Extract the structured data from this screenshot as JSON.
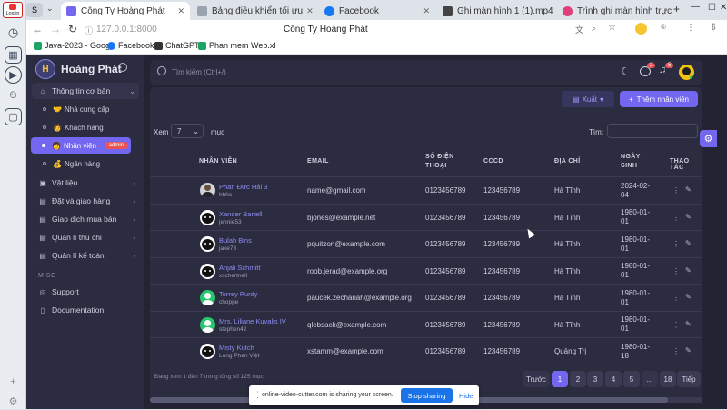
{
  "dock": {
    "login": "Log in"
  },
  "tabs": [
    {
      "label": "Công Ty Hoàng Phát",
      "active": true
    },
    {
      "label": "Bảng điều khiển tối ưu",
      "active": false
    },
    {
      "label": "Facebook",
      "active": false
    },
    {
      "label": "Ghi màn hình 1 (1).mp4",
      "active": false
    },
    {
      "label": "Trình ghi màn hình trực",
      "active": false
    }
  ],
  "address": {
    "url": "127.0.0.1:8000",
    "page_title": "Công Ty Hoàng Phát"
  },
  "bookmarks": [
    "Java-2023 - Googl",
    "Facebook",
    "ChatGPT",
    "Phan mem Web.xl"
  ],
  "brand": {
    "name": "Hoàng Phát"
  },
  "sidebar": {
    "group_title": "Thông tin cơ bản",
    "sub_items": [
      {
        "label": "Nhà cung cấp",
        "emoji": "🤝"
      },
      {
        "label": "Khách hàng",
        "emoji": "🧑"
      },
      {
        "label": "Nhân viên",
        "emoji": "🧑",
        "badge": "admin"
      },
      {
        "label": "Ngân hàng",
        "emoji": "💰"
      }
    ],
    "items": [
      "Vật liệu",
      "Đặt và giao hàng",
      "Giao dịch mua bán",
      "Quản lí thu chi",
      "Quản lí kế toán"
    ],
    "misc_title": "MISC",
    "misc_items": [
      "Support",
      "Documentation"
    ]
  },
  "search": {
    "placeholder": "Tìm kiếm (Ctrl+/)"
  },
  "header_badges": {
    "messages": "2",
    "notifications": "5"
  },
  "toolbar": {
    "export": "Xuất",
    "add_employee": "Thêm nhân viên"
  },
  "list_controls": {
    "show_label": "Xem",
    "show_value": "7",
    "entries_label": "mục",
    "search_label": "Tìm:"
  },
  "table": {
    "columns": [
      "NHÂN VIÊN",
      "EMAIL",
      "SỐ ĐIỆN THOẠI",
      "CCCD",
      "ĐỊA CHỈ",
      "NGÀY SINH",
      "THAO TÁC"
    ],
    "rows": [
      {
        "name": "Phan Đức Hải 3",
        "username": "hhhc",
        "email": "name@gmail.com",
        "phone": "0123456789",
        "cccd": "123456789",
        "address": "Hà Tĩnh",
        "dob": "2024-02-04",
        "avatar": "photo"
      },
      {
        "name": "Xander Bartell",
        "username": "jennie53",
        "email": "bjones@example.net",
        "phone": "0123456789",
        "cccd": "123456789",
        "address": "Hà Tĩnh",
        "dob": "1980-01-01",
        "avatar": "cat"
      },
      {
        "name": "Bulah Bins",
        "username": "jake78",
        "email": "pquitzon@example.com",
        "phone": "0123456789",
        "cccd": "123456789",
        "address": "Hà Tĩnh",
        "dob": "1980-01-01",
        "avatar": "cat"
      },
      {
        "name": "Anjali Schmitt",
        "username": "xschertnell",
        "email": "roob.jerad@example.org",
        "phone": "0123456789",
        "cccd": "123456789",
        "address": "Hà Tĩnh",
        "dob": "1980-01-01",
        "avatar": "cat"
      },
      {
        "name": "Torrey Purdy",
        "username": "choppe",
        "email": "paucek.zechariah@example.org",
        "phone": "0123456789",
        "cccd": "123456789",
        "address": "Hà Tĩnh",
        "dob": "1980-01-01",
        "avatar": "person"
      },
      {
        "name": "Mrs. Liliane Kuvalis IV",
        "username": "stephen42",
        "email": "qlebsack@example.com",
        "phone": "0123456789",
        "cccd": "123456789",
        "address": "Hà Tĩnh",
        "dob": "1980-01-01",
        "avatar": "person"
      },
      {
        "name": "Misty Kutch",
        "username": "Long Phan Việt",
        "email": "xstamm@example.com",
        "phone": "0123456789",
        "cccd": "123456789",
        "address": "Quảng Trị",
        "dob": "1980-01-18",
        "avatar": "cat"
      }
    ]
  },
  "footer": {
    "info": "Đang xem 1 đến 7 trong tổng số 125 mục"
  },
  "pagination": {
    "prev": "Trước",
    "pages": [
      "1",
      "2",
      "3",
      "4",
      "5",
      "...",
      "18"
    ],
    "next": "Tiếp",
    "current": "1"
  },
  "share_bar": {
    "message": "online-video-cutter.com is sharing your screen.",
    "stop": "Stop sharing",
    "hide": "Hide"
  },
  "colors": {
    "accent": "#7367f0",
    "danger": "#ea5455",
    "sidebar": "#2b2c40",
    "background": "#232333"
  }
}
